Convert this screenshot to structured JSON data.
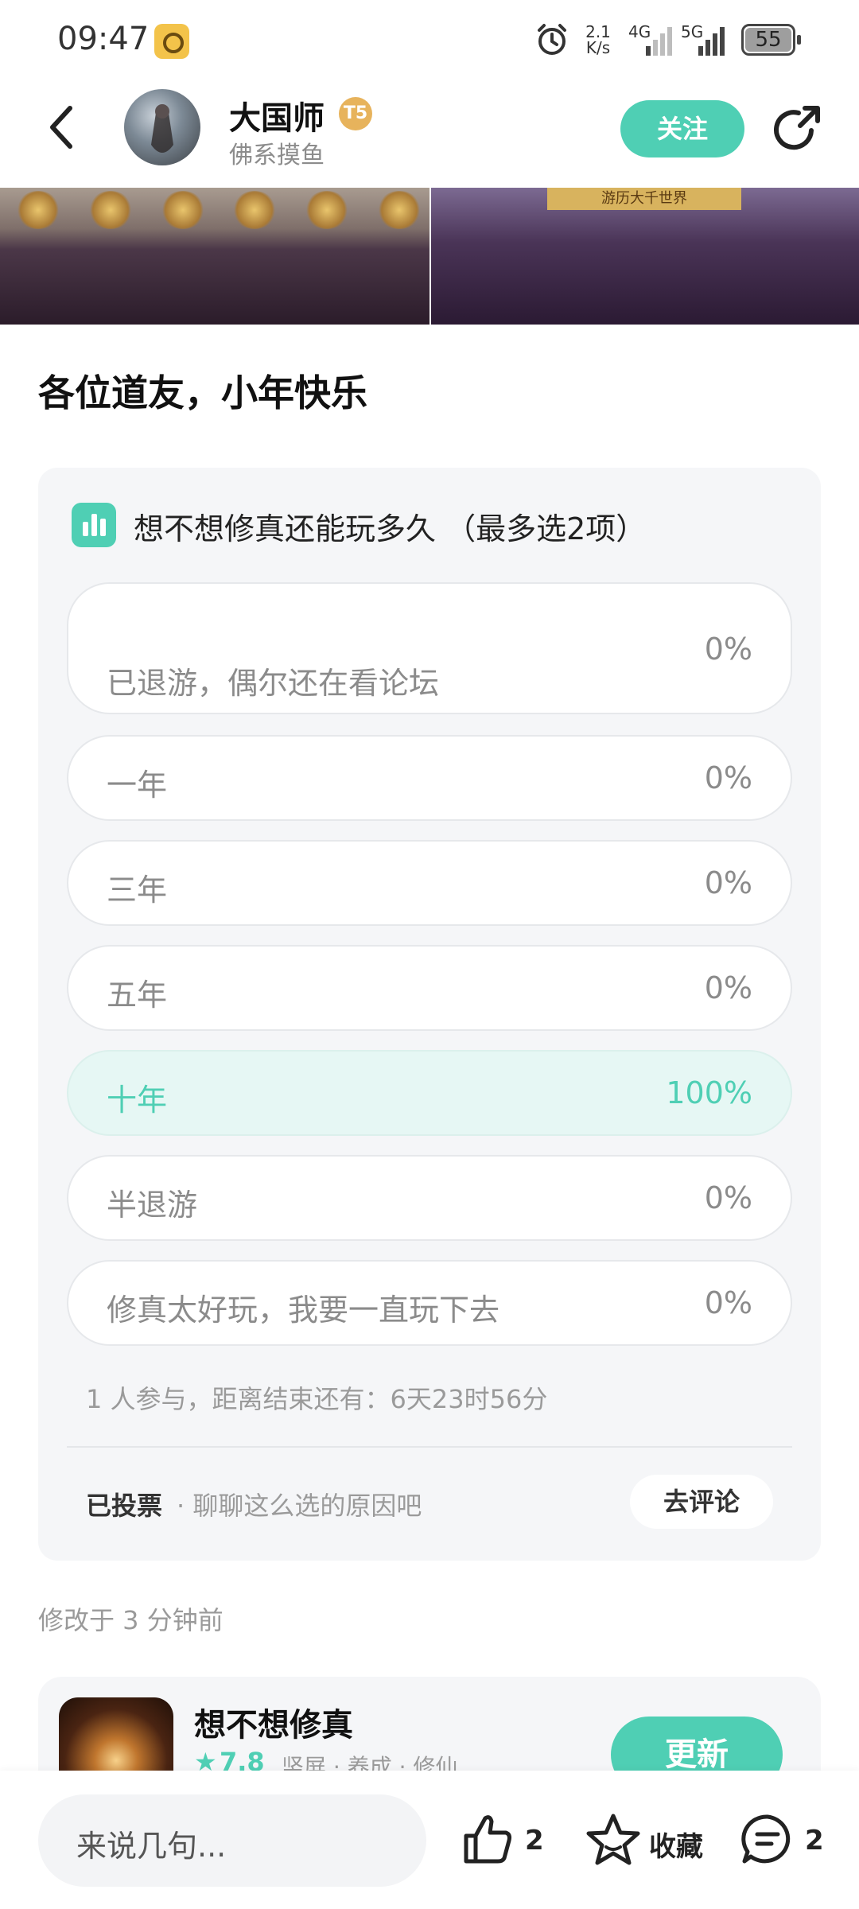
{
  "status_bar": {
    "time": "09:47",
    "net_speed_value": "2.1",
    "net_speed_unit": "K/s",
    "network_1": "4G",
    "network_2": "5G",
    "battery": "55"
  },
  "header": {
    "username": "大国师",
    "level_badge": "T5",
    "subtitle": "佛系摸鱼",
    "follow_label": "关注"
  },
  "banner": {
    "tag_text": "游历大千世界"
  },
  "post": {
    "title": "各位道友，小年快乐"
  },
  "poll": {
    "question": "想不想修真还能玩多久 （最多选2项）",
    "options": [
      {
        "label": "已退游，偶尔还在看论坛",
        "percent": "0%"
      },
      {
        "label": "一年",
        "percent": "0%"
      },
      {
        "label": "三年",
        "percent": "0%"
      },
      {
        "label": "五年",
        "percent": "0%"
      },
      {
        "label": "十年",
        "percent": "100%"
      },
      {
        "label": "半退游",
        "percent": "0%"
      },
      {
        "label": "修真太好玩，我要一直玩下去",
        "percent": "0%"
      }
    ],
    "selected_index": 4,
    "meta": "1 人参与，距离结束还有：6天23时56分",
    "voted_label": "已投票",
    "voted_sub": "· 聊聊这么选的原因吧",
    "comment_button": "去评论"
  },
  "edited": "修改于 3 分钟前",
  "game": {
    "name": "想不想修真",
    "rating": "7.8",
    "tags": "竖屏 · 养成 · 修仙",
    "update_label": "更新"
  },
  "bottom_bar": {
    "comment_placeholder": "来说几句...",
    "like_count": "2",
    "collect_label": "收藏",
    "comment_count": "2"
  },
  "colors": {
    "accent": "#4fcfb4"
  }
}
